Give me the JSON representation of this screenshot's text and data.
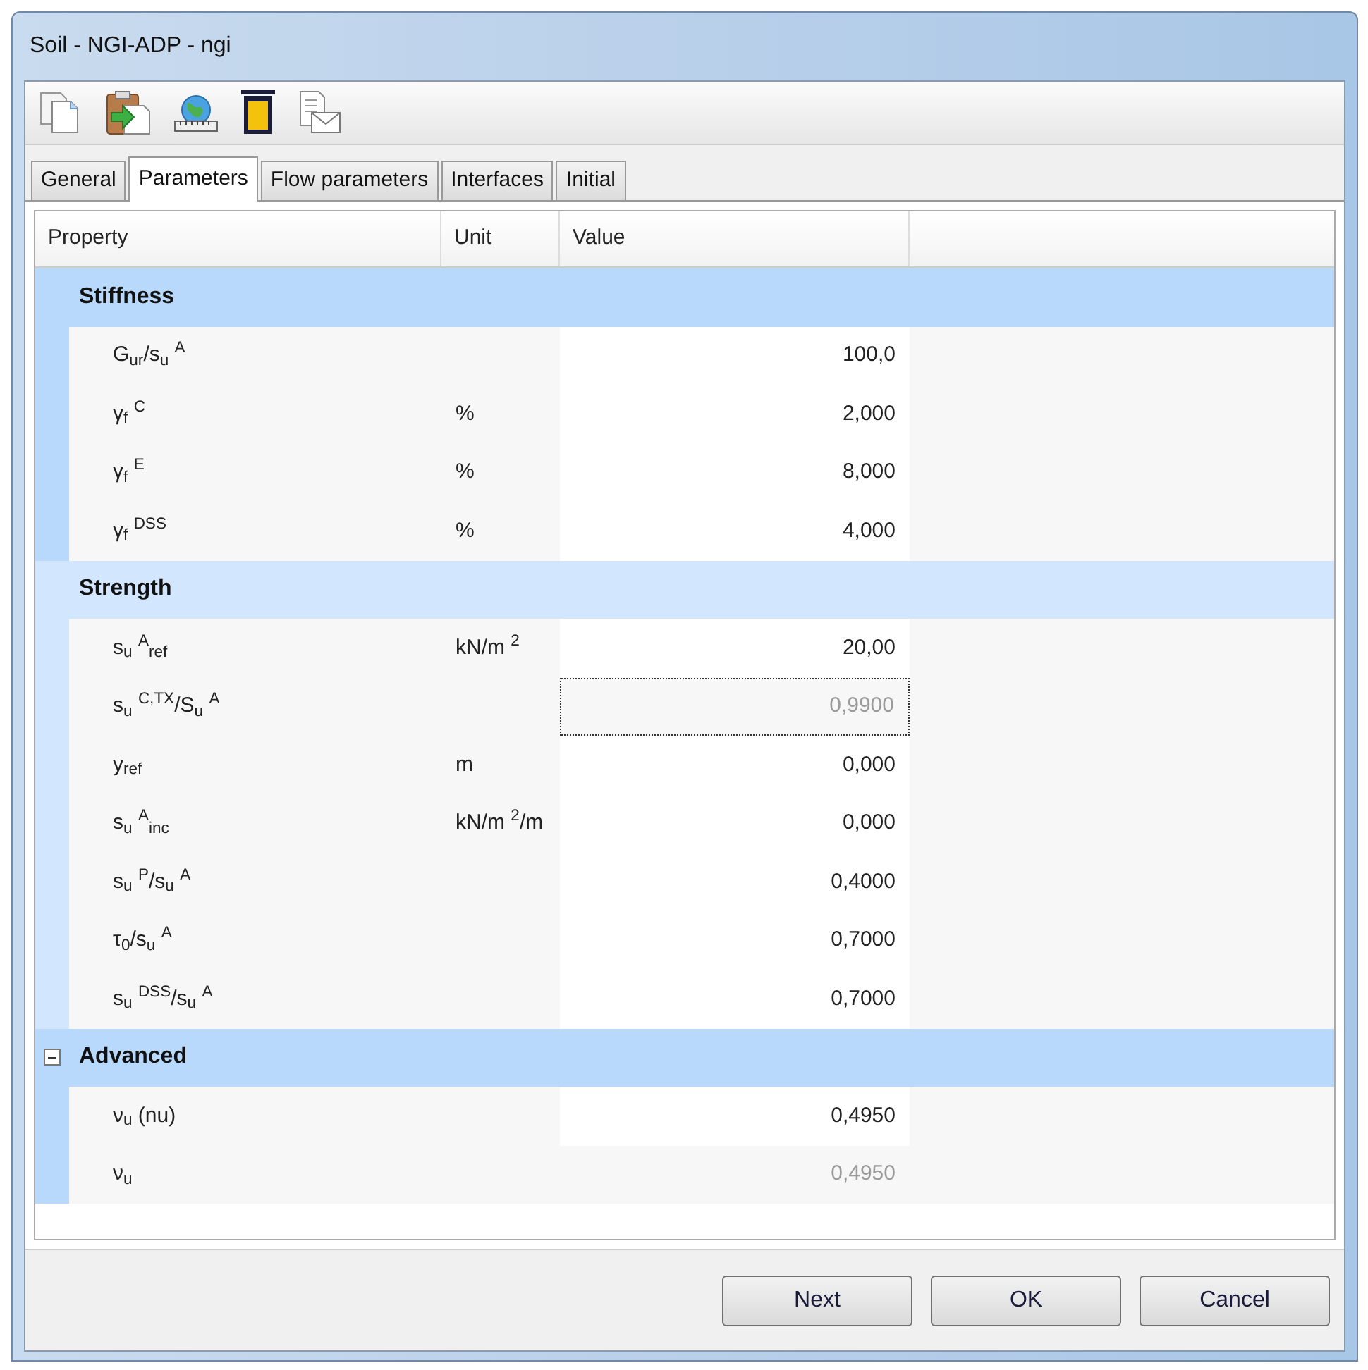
{
  "window": {
    "title": "Soil - NGI-ADP - ngi"
  },
  "tabs": [
    {
      "label": "General",
      "selected": false
    },
    {
      "label": "Parameters",
      "selected": true
    },
    {
      "label": "Flow parameters",
      "selected": false
    },
    {
      "label": "Interfaces",
      "selected": false
    },
    {
      "label": "Initial",
      "selected": false
    }
  ],
  "table": {
    "columns": [
      "Property",
      "Unit",
      "Value"
    ],
    "groups": [
      {
        "title": "Stiffness",
        "rows": [
          {
            "property": "G$_{ur}$/s$_{u}$ $^{A}$",
            "value": "100,0",
            "disabled": false,
            "focused": false
          },
          {
            "property": "γ$_{f}$ $^{C}$",
            "unit": "%",
            "value": "2,000",
            "disabled": false,
            "focused": false
          },
          {
            "property": "γ$_{f}$ $^{E}$",
            "unit": "%",
            "value": "8,000",
            "disabled": false,
            "focused": false
          },
          {
            "property": "γ$_{f}$ $^{DSS}$",
            "unit": "%",
            "value": "4,000",
            "disabled": false,
            "focused": false
          }
        ]
      },
      {
        "title": "Strength",
        "rows": [
          {
            "property": "s$_{u}$ $^{A}$$_{ref}$",
            "unit": "kN/m $^{2}$",
            "value": "20,00",
            "disabled": false,
            "focused": false
          },
          {
            "property": "s$_{u}$ $^{C,TX}$/S$_{u}$ $^{A}$",
            "value": "0,9900",
            "disabled": true,
            "focused": true
          },
          {
            "property": "y$_{ref}$",
            "unit": "m",
            "value": "0,000",
            "disabled": false,
            "focused": false
          },
          {
            "property": "s$_{u}$ $^{A}$$_{inc}$",
            "unit": "kN/m $^{2}$/m",
            "value": "0,000",
            "disabled": false,
            "focused": false
          },
          {
            "property": "s$_{u}$ $^{P}$/s$_{u}$ $^{A}$",
            "value": "0,4000",
            "disabled": false,
            "focused": false
          },
          {
            "property": "τ$_{0}$/s$_{u}$ $^{A}$",
            "value": "0,7000",
            "disabled": false,
            "focused": false
          },
          {
            "property": "s$_{u}$ $^{DSS}$/s$_{u}$ $^{A}$",
            "value": "0,7000",
            "disabled": false,
            "focused": false
          }
        ]
      },
      {
        "title": "Advanced",
        "expanded": true,
        "rows": [
          {
            "property": "ν$_{u}$ (nu)",
            "value": "0,4950",
            "disabled": false,
            "focused": false
          },
          {
            "property": "ν$_{u}$",
            "value": "0,4950",
            "disabled": true,
            "focused": false
          }
        ]
      }
    ]
  },
  "buttons": [
    "Next",
    "OK",
    "Cancel"
  ]
}
